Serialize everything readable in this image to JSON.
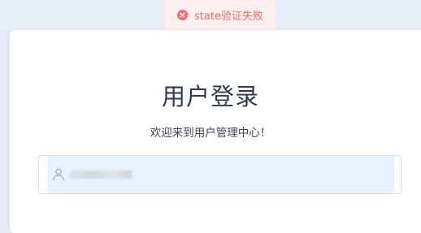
{
  "toast": {
    "icon": "error-circle-icon",
    "message": "state验证失败",
    "color": "#f56c6c"
  },
  "login": {
    "title": "用户登录",
    "subtitle": "欢迎来到用户管理中心！",
    "username_icon": "user-icon"
  }
}
